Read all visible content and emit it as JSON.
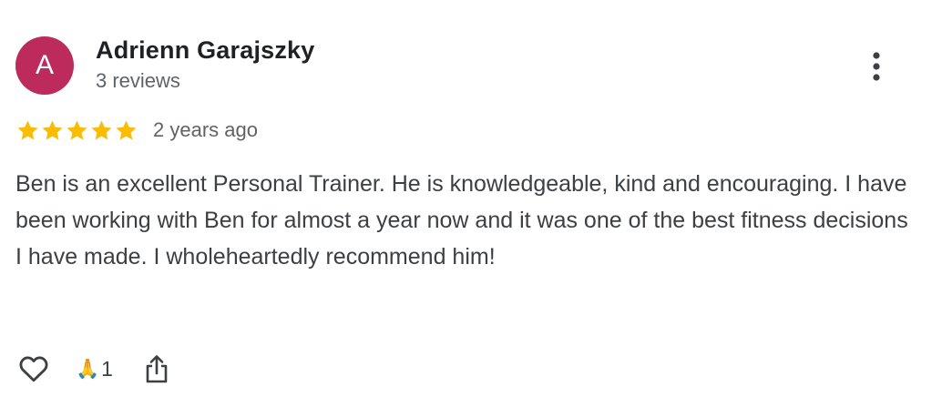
{
  "reviewer": {
    "avatar_letter": "A",
    "avatar_color": "#bd2b5c",
    "name": "Adrienn Garajszky",
    "reviews_count": "3 reviews"
  },
  "review": {
    "rating": 5,
    "max_rating": 5,
    "star_color": "#fbbc04",
    "date": "2 years ago",
    "text": "Ben is an excellent Personal Trainer. He is knowledgeable, kind and encouraging. I have been working with Ben for almost a year now and it was one of the best fitness decisions I have made. I wholeheartedly recommend him!"
  },
  "actions": {
    "like_icon": "heart-outline-icon",
    "reaction_emoji": "🙏",
    "reaction_count": "1",
    "share_icon": "share-icon",
    "more_icon": "more-vertical-icon"
  }
}
